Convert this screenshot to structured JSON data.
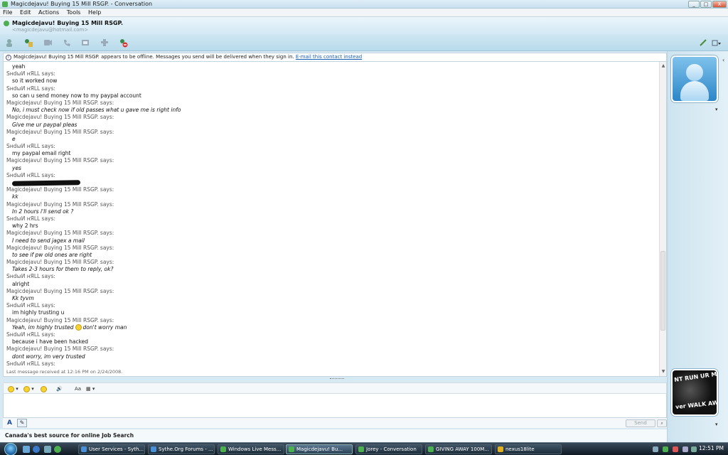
{
  "window": {
    "title": "Magicdejavu!     Buying 15 Mill RSGP. - Conversation",
    "controls": [
      "_",
      "□",
      "X"
    ]
  },
  "menu": [
    "File",
    "Edit",
    "Actions",
    "Tools",
    "Help"
  ],
  "contact": {
    "name": "Magicdejavu!     Buying 15 Mill RSGP.",
    "email": "<magicdejavu@hotmail.com>"
  },
  "toolbar": {
    "icons": [
      "invite-icon",
      "share-files-icon",
      "video-call-icon",
      "call-icon",
      "activities-icon",
      "games-icon",
      "block-icon"
    ],
    "right_icons": [
      "paint-icon",
      "options-icon"
    ]
  },
  "infobar": {
    "text": "Magicdejavu!     Buying 15 Mill RSGP. appears to be offline. Messages you send will be delivered when they sign in.",
    "link": "E-mail this contact instead"
  },
  "conversation": [
    {
      "type": "msg",
      "text": "yeah",
      "style": "plain"
    },
    {
      "type": "sender",
      "text": "SнdωИ нЯLL says:"
    },
    {
      "type": "msg",
      "text": "so it worked now",
      "style": "plain"
    },
    {
      "type": "sender",
      "text": "SнdωИ нЯLL says:"
    },
    {
      "type": "msg",
      "text": "so can u send money now to my paypal account",
      "style": "plain"
    },
    {
      "type": "sender",
      "text": "Magicdejavu!     Buying 15 Mill RSGP. says:"
    },
    {
      "type": "msg",
      "text": "No, i must check now if old passes what u gave me is right info",
      "style": "hand"
    },
    {
      "type": "sender",
      "text": "Magicdejavu!     Buying 15 Mill RSGP. says:"
    },
    {
      "type": "msg",
      "text": "Give me ur paypal pleas",
      "style": "hand"
    },
    {
      "type": "sender",
      "text": "Magicdejavu!     Buying 15 Mill RSGP. says:"
    },
    {
      "type": "msg",
      "text": "e",
      "style": "hand"
    },
    {
      "type": "sender",
      "text": "SнdωИ нЯLL says:"
    },
    {
      "type": "msg",
      "text": "my paypal email right",
      "style": "plain"
    },
    {
      "type": "sender",
      "text": "Magicdejavu!     Buying 15 Mill RSGP. says:"
    },
    {
      "type": "msg",
      "text": "yes",
      "style": "hand"
    },
    {
      "type": "sender",
      "text": "SнdωИ нЯLL says:"
    },
    {
      "type": "redacted",
      "text": ""
    },
    {
      "type": "sender",
      "text": "Magicdejavu!     Buying 15 Mill RSGP. says:"
    },
    {
      "type": "msg",
      "text": "kk",
      "style": "hand"
    },
    {
      "type": "sender",
      "text": "Magicdejavu!     Buying 15 Mill RSGP. says:"
    },
    {
      "type": "msg",
      "text": "In 2 hours i'll send ok ?",
      "style": "hand"
    },
    {
      "type": "sender",
      "text": "SнdωИ нЯLL says:"
    },
    {
      "type": "msg",
      "text": "why 2 hrs",
      "style": "plain"
    },
    {
      "type": "sender",
      "text": "Magicdejavu!     Buying 15 Mill RSGP. says:"
    },
    {
      "type": "msg",
      "text": "I need to send jagex a mail",
      "style": "hand"
    },
    {
      "type": "sender",
      "text": "Magicdejavu!     Buying 15 Mill RSGP. says:"
    },
    {
      "type": "msg",
      "text": "to see if pw old ones are right",
      "style": "hand"
    },
    {
      "type": "sender",
      "text": "Magicdejavu!     Buying 15 Mill RSGP. says:"
    },
    {
      "type": "msg",
      "text": "Takes 2-3 hours for them to reply, ok?",
      "style": "hand"
    },
    {
      "type": "sender",
      "text": "SнdωИ нЯLL says:"
    },
    {
      "type": "msg",
      "text": "alright",
      "style": "plain"
    },
    {
      "type": "sender",
      "text": "Magicdejavu!     Buying 15 Mill RSGP. says:"
    },
    {
      "type": "msg",
      "text": "Kk tyvm",
      "style": "hand"
    },
    {
      "type": "sender",
      "text": "SнdωИ нЯLL says:"
    },
    {
      "type": "msg",
      "text": "im highly trusting u",
      "style": "plain"
    },
    {
      "type": "sender",
      "text": "Magicdejavu!     Buying 15 Mill RSGP. says:"
    },
    {
      "type": "smiley",
      "before": "Yeah, im highly trusted",
      "after": "don't worry man",
      "style": "hand"
    },
    {
      "type": "sender",
      "text": "SнdωИ нЯLL says:"
    },
    {
      "type": "msg",
      "text": "because i have been hacked",
      "style": "plain"
    },
    {
      "type": "sender",
      "text": "Magicdejavu!     Buying 15 Mill RSGP. says:"
    },
    {
      "type": "msg",
      "text": "dont worry, im very trusted",
      "style": "hand"
    },
    {
      "type": "sender",
      "text": "SнdωИ нЯLL says:"
    }
  ],
  "last_message": "Last message received at 12:16 PM on 2/24/2008.",
  "compose": {
    "send_label": "Send",
    "font_label": "A"
  },
  "ad_text": "Canada's best source for online Job Search",
  "display_picture_text": {
    "line1": "NT RUN  UR MSG",
    "line2": "ver  WALK AW"
  },
  "taskbar": {
    "tasks": [
      {
        "label": "User Services - Syth...",
        "active": false,
        "color": "#4a90d9"
      },
      {
        "label": "Sythe.Org Forums - ...",
        "active": false,
        "color": "#4a90d9"
      },
      {
        "label": "Windows Live Mess...",
        "active": false,
        "color": "#4caf50"
      },
      {
        "label": "Magicdejavu!     Bu...",
        "active": true,
        "color": "#4caf50"
      },
      {
        "label": "Jorey - Conversation",
        "active": false,
        "color": "#4caf50"
      },
      {
        "label": "GIVING AWAY 100M...",
        "active": false,
        "color": "#4caf50"
      },
      {
        "label": "nexus18lite",
        "active": false,
        "color": "#e0b020"
      }
    ],
    "clock": "12:51 PM"
  }
}
